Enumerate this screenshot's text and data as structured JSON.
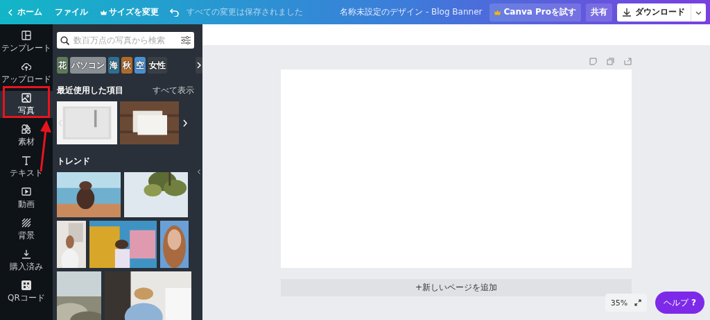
{
  "topbar": {
    "home": "ホーム",
    "file": "ファイル",
    "resize": "サイズを変更",
    "saved_status": "すべての変更は保存されました",
    "design_title": "名称未設定のデザイン - Blog Banner",
    "pro_button": "Canva Proを試す",
    "share_button": "共有",
    "download_button": "ダウンロード"
  },
  "sidebar": {
    "items": [
      {
        "label": "テンプレート",
        "selected": false
      },
      {
        "label": "アップロード",
        "selected": false
      },
      {
        "label": "写真",
        "selected": true
      },
      {
        "label": "素材",
        "selected": false
      },
      {
        "label": "テキスト",
        "selected": false
      },
      {
        "label": "動画",
        "selected": false
      },
      {
        "label": "背景",
        "selected": false
      },
      {
        "label": "購入済み",
        "selected": false
      },
      {
        "label": "QRコード",
        "selected": false
      }
    ]
  },
  "panel": {
    "search": {
      "placeholder": "数百万点の写真から検索"
    },
    "chips": [
      "花",
      "パソコン",
      "海",
      "秋",
      "空",
      "女性"
    ],
    "recent": {
      "heading": "最近使用した項目",
      "see_all": "すべて表示"
    },
    "trend": {
      "heading": "トレンド"
    }
  },
  "editor": {
    "add_page": "+新しいページを追加",
    "zoom": "35%",
    "help": "ヘルプ",
    "help_mark": "?"
  }
}
